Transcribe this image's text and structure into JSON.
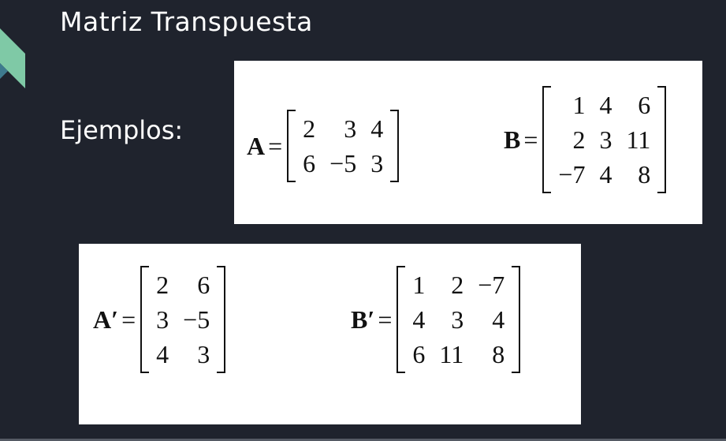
{
  "slide": {
    "title": "Matriz Transpuesta",
    "examples_label": "Ejemplos:",
    "accent_color": "#7fc9a6"
  },
  "matrices": {
    "A": {
      "name": "A",
      "eq": "=",
      "rows": [
        [
          "2",
          "3",
          "4"
        ],
        [
          "6",
          "−5",
          "3"
        ]
      ]
    },
    "B": {
      "name": "B",
      "eq": "=",
      "rows": [
        [
          "1",
          "4",
          "6"
        ],
        [
          "2",
          "3",
          "11"
        ],
        [
          "−7",
          "4",
          "8"
        ]
      ]
    },
    "At": {
      "name": "A′",
      "eq": "=",
      "rows": [
        [
          "2",
          "6"
        ],
        [
          "3",
          "−5"
        ],
        [
          "4",
          "3"
        ]
      ]
    },
    "Bt": {
      "name": "B′",
      "eq": "=",
      "rows": [
        [
          "1",
          "2",
          "−7"
        ],
        [
          "4",
          "3",
          "4"
        ],
        [
          "6",
          "11",
          "8"
        ]
      ]
    }
  }
}
